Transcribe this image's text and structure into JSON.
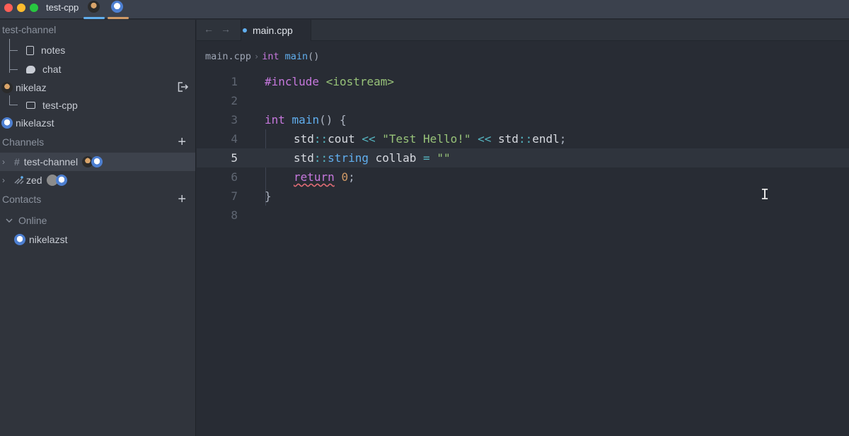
{
  "titlebar": {
    "project": "test-cpp",
    "avatars": [
      "collaborator-avatar-1",
      "collaborator-avatar-2"
    ]
  },
  "sidebar": {
    "channel_header": "test-channel",
    "channel_children": [
      {
        "icon": "document-icon",
        "label": "notes"
      },
      {
        "icon": "chat-icon",
        "label": "chat"
      }
    ],
    "participants": [
      {
        "name": "nikelaz",
        "projects": [
          {
            "icon": "folder-icon",
            "label": "test-cpp"
          }
        ]
      },
      {
        "name": "nikelazst"
      }
    ],
    "channels_header": "Channels",
    "channels": [
      {
        "prefix": "#",
        "name": "test-channel",
        "selected": true
      },
      {
        "prefix": "zed-icon",
        "name": "zed",
        "selected": false
      }
    ],
    "contacts_header": "Contacts",
    "online_header": "Online",
    "online_contacts": [
      "nikelazst"
    ]
  },
  "tabs": [
    {
      "label": "main.cpp",
      "active": true
    }
  ],
  "breadcrumb": {
    "file": "main.cpp",
    "separator": "›",
    "symbol_kw": "int",
    "symbol_fn": "main",
    "symbol_parens": "()"
  },
  "editor": {
    "active_line": 5,
    "line_numbers": [
      "1",
      "2",
      "3",
      "4",
      "5",
      "6",
      "7",
      "8"
    ],
    "lines": {
      "l1": {
        "pre": "#include",
        "inc": "<iostream>"
      },
      "l3": {
        "kw": "int",
        "fn": "main",
        "rest": "() {"
      },
      "l4": {
        "ns1": "std",
        "sep1": "::",
        "id1": "cout",
        "op1": "<<",
        "str": "\"Test Hello!\"",
        "op2": "<<",
        "ns2": "std",
        "sep2": "::",
        "id2": "endl",
        "end": ";"
      },
      "l5": {
        "ns": "std",
        "sep": "::",
        "type": "string",
        "id": "collab",
        "op": "=",
        "str": "\"\""
      },
      "l6": {
        "kw": "return",
        "num": "0",
        "end": ";"
      },
      "l7": {
        "brace": "}"
      }
    }
  },
  "colors": {
    "keyword": "#c678dd",
    "function": "#61afef",
    "string": "#98c379",
    "number": "#d19a66",
    "operator": "#56b6c2",
    "error_squiggle": "#e06c75"
  }
}
